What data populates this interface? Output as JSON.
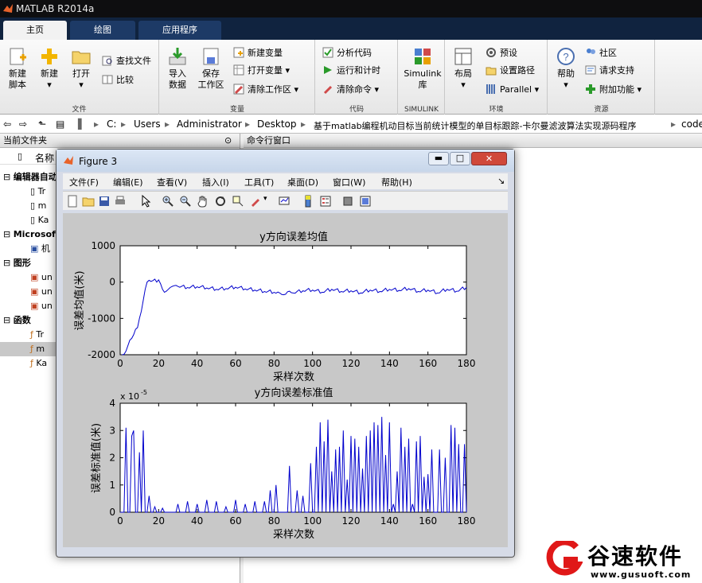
{
  "app": {
    "title": "MATLAB R2014a"
  },
  "tabs": [
    {
      "label": "主页",
      "active": true
    },
    {
      "label": "绘图",
      "active": false
    },
    {
      "label": "应用程序",
      "active": false
    }
  ],
  "ribbon": {
    "file": {
      "group_label": "文件",
      "new_script": "新建\n脚本",
      "new": "新建",
      "open": "打开",
      "find_files": "查找文件",
      "compare": "比较"
    },
    "variable": {
      "group_label": "变量",
      "import": "导入\n数据",
      "save_ws": "保存\n工作区",
      "new_var": "新建变量",
      "open_var": "打开变量",
      "clear_ws": "清除工作区"
    },
    "code": {
      "group_label": "代码",
      "analyze": "分析代码",
      "run_time": "运行和计时",
      "clear_cmd": "清除命令"
    },
    "simulink": {
      "group_label": "SIMULINK",
      "lib": "Simulink\n库"
    },
    "env": {
      "group_label": "环境",
      "layout": "布局",
      "prefs": "预设",
      "set_path": "设置路径",
      "parallel": "Parallel"
    },
    "resources": {
      "group_label": "资源",
      "help": "帮助",
      "community": "社区",
      "support": "请求支持",
      "addons": "附加功能"
    }
  },
  "address": {
    "parts": [
      "C:",
      "Users",
      "Administrator",
      "Desktop",
      "基于matlab编程机动目标当前统计模型的单目标跟踪-卡尔曼滤波算法实现源码程序",
      "code"
    ]
  },
  "left_panel": {
    "title": "当前文件夹",
    "col_name": "名称",
    "sections": [
      {
        "label": "编辑器自动",
        "items": [
          "Tr",
          "m",
          "Ka"
        ]
      },
      {
        "label": "Microsoft",
        "items": [
          "机"
        ]
      },
      {
        "label": "图形",
        "items": [
          "un",
          "un",
          "un"
        ]
      },
      {
        "label": "函数",
        "items": [
          "Tr",
          "m",
          "Ka"
        ]
      }
    ]
  },
  "cmd_panel": {
    "title": "命令行窗口"
  },
  "figure": {
    "title": "Figure 3",
    "menu": [
      "文件(F)",
      "编辑(E)",
      "查看(V)",
      "插入(I)",
      "工具(T)",
      "桌面(D)",
      "窗口(W)",
      "帮助(H)"
    ]
  },
  "chart_data": [
    {
      "type": "line",
      "title": "y方向误差均值",
      "xlabel": "采样次数",
      "ylabel": "误差均值(米)",
      "xlim": [
        0,
        180
      ],
      "ylim": [
        -2000,
        1000
      ],
      "xticks": [
        0,
        20,
        40,
        60,
        80,
        100,
        120,
        140,
        160,
        180
      ],
      "yticks": [
        -2000,
        -1000,
        0,
        1000
      ],
      "color": "#0000cc",
      "x": [
        1,
        2,
        3,
        4,
        5,
        6,
        7,
        8,
        9,
        10,
        11,
        12,
        13,
        14,
        15,
        16,
        17,
        18,
        19,
        20,
        21,
        22,
        23,
        24,
        25,
        26,
        27,
        28,
        29,
        30,
        35,
        40,
        45,
        50,
        55,
        60,
        65,
        70,
        75,
        80,
        83,
        85,
        88,
        90,
        95,
        100,
        105,
        110,
        115,
        120,
        125,
        130,
        135,
        140,
        145,
        150,
        155,
        160,
        165,
        170,
        175,
        180
      ],
      "y": [
        -2000,
        -1990,
        -1900,
        -1750,
        -1600,
        -1550,
        -1450,
        -1300,
        -1250,
        -1000,
        -800,
        -500,
        -200,
        0,
        50,
        20,
        40,
        80,
        0,
        60,
        -50,
        -200,
        -280,
        -250,
        -200,
        -150,
        -120,
        -100,
        -90,
        -120,
        -150,
        -130,
        -160,
        -200,
        -180,
        -140,
        -190,
        -220,
        -260,
        -280,
        -300,
        -350,
        -250,
        -300,
        -240,
        -220,
        -280,
        -200,
        -260,
        -240,
        -300,
        -220,
        -260,
        -200,
        -230,
        -180,
        -260,
        -220,
        -300,
        -200,
        -250,
        -150
      ]
    },
    {
      "type": "line",
      "title": "y方向误差标准值",
      "xlabel": "采样次数",
      "ylabel": "误差标准值(米)",
      "exponent_label": "x 10",
      "exponent": "-5",
      "xlim": [
        0,
        180
      ],
      "ylim": [
        0,
        4
      ],
      "xticks": [
        0,
        20,
        40,
        60,
        80,
        100,
        120,
        140,
        160,
        180
      ],
      "yticks": [
        0,
        1,
        2,
        3,
        4
      ],
      "color": "#0000cc",
      "spikes": [
        [
          3,
          3.1
        ],
        [
          6,
          2.8
        ],
        [
          7,
          3.0
        ],
        [
          10,
          2.2
        ],
        [
          12,
          3.0
        ],
        [
          15,
          0.6
        ],
        [
          18,
          0.2
        ],
        [
          22,
          0.15
        ],
        [
          30,
          0.3
        ],
        [
          35,
          0.4
        ],
        [
          40,
          0.3
        ],
        [
          45,
          0.45
        ],
        [
          50,
          0.4
        ],
        [
          55,
          0.2
        ],
        [
          60,
          0.45
        ],
        [
          65,
          0.3
        ],
        [
          70,
          0.4
        ],
        [
          75,
          0.4
        ],
        [
          78,
          0.8
        ],
        [
          81,
          1.0
        ],
        [
          88,
          1.7
        ],
        [
          92,
          0.8
        ],
        [
          95,
          0.6
        ],
        [
          99,
          1.8
        ],
        [
          102,
          2.4
        ],
        [
          104,
          3.3
        ],
        [
          106,
          2.6
        ],
        [
          108,
          3.4
        ],
        [
          110,
          1.5
        ],
        [
          112,
          2.3
        ],
        [
          114,
          2.4
        ],
        [
          116,
          3.0
        ],
        [
          118,
          1.2
        ],
        [
          120,
          2.8
        ],
        [
          122,
          2.7
        ],
        [
          124,
          2.4
        ],
        [
          126,
          1.6
        ],
        [
          128,
          2.8
        ],
        [
          130,
          3.0
        ],
        [
          132,
          3.3
        ],
        [
          134,
          3.2
        ],
        [
          136,
          3.5
        ],
        [
          138,
          2.1
        ],
        [
          140,
          3.3
        ],
        [
          142,
          0.3
        ],
        [
          144,
          1.5
        ],
        [
          146,
          3.1
        ],
        [
          148,
          2.4
        ],
        [
          150,
          2.7
        ],
        [
          152,
          0.3
        ],
        [
          154,
          2.6
        ],
        [
          156,
          2.8
        ],
        [
          158,
          1.3
        ],
        [
          160,
          1.4
        ],
        [
          162,
          2.3
        ],
        [
          166,
          2.3
        ],
        [
          169,
          2.0
        ],
        [
          172,
          3.2
        ],
        [
          174,
          3.1
        ],
        [
          176,
          2.5
        ],
        [
          179,
          2.5
        ]
      ]
    }
  ],
  "watermark": {
    "brand": "谷速软件",
    "url": "www.gusuoft.com"
  }
}
